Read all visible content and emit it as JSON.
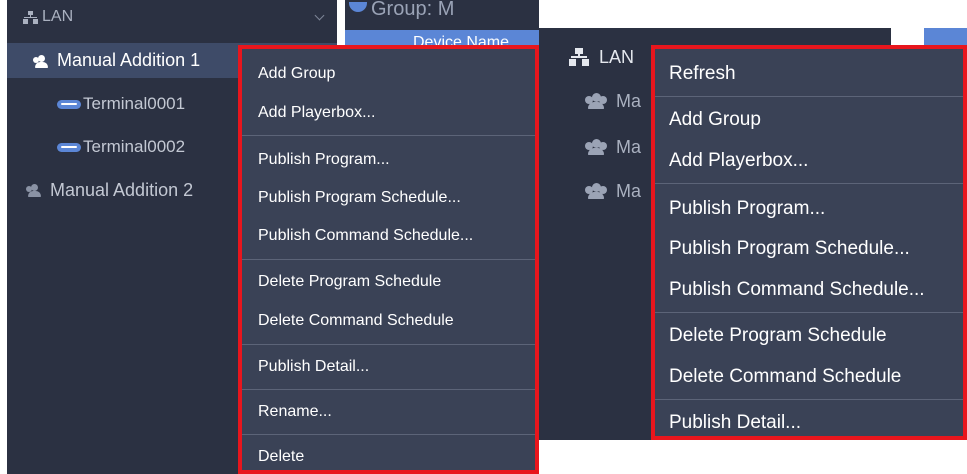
{
  "left_tree": {
    "root_label": "LAN",
    "groups": [
      {
        "label": "Manual Addition 1",
        "terminals": [
          "Terminal0001",
          "Terminal0002"
        ]
      },
      {
        "label": "Manual Addition 2",
        "terminals": []
      }
    ]
  },
  "background_table": {
    "group_title": "Group: M",
    "device_name_header": "Device Name"
  },
  "right_tree": {
    "root_label": "LAN",
    "groups": [
      "Ma",
      "Ma",
      "Ma"
    ]
  },
  "context_menu_left": {
    "items": [
      "Add Group",
      "Add Playerbox...",
      "Publish Program...",
      "Publish Program Schedule...",
      "Publish Command Schedule...",
      "Delete Program Schedule",
      "Delete Command Schedule",
      "Publish Detail...",
      "Rename...",
      "Delete"
    ]
  },
  "context_menu_right": {
    "items": [
      "Refresh",
      "Add Group",
      "Add Playerbox...",
      "Publish Program...",
      "Publish Program Schedule...",
      "Publish Command Schedule...",
      "Delete Program Schedule",
      "Delete Command Schedule",
      "Publish Detail..."
    ]
  },
  "colors": {
    "panel_bg": "#2b3142",
    "menu_bg": "#3a4256",
    "highlight_border": "#e8161d",
    "selected_row": "#3e4b68",
    "accent_blue": "#5b86d6"
  },
  "icons": {
    "root": "network-icon",
    "group": "users-icon",
    "terminal": "terminal-icon",
    "expand": "chevron-down-icon"
  }
}
